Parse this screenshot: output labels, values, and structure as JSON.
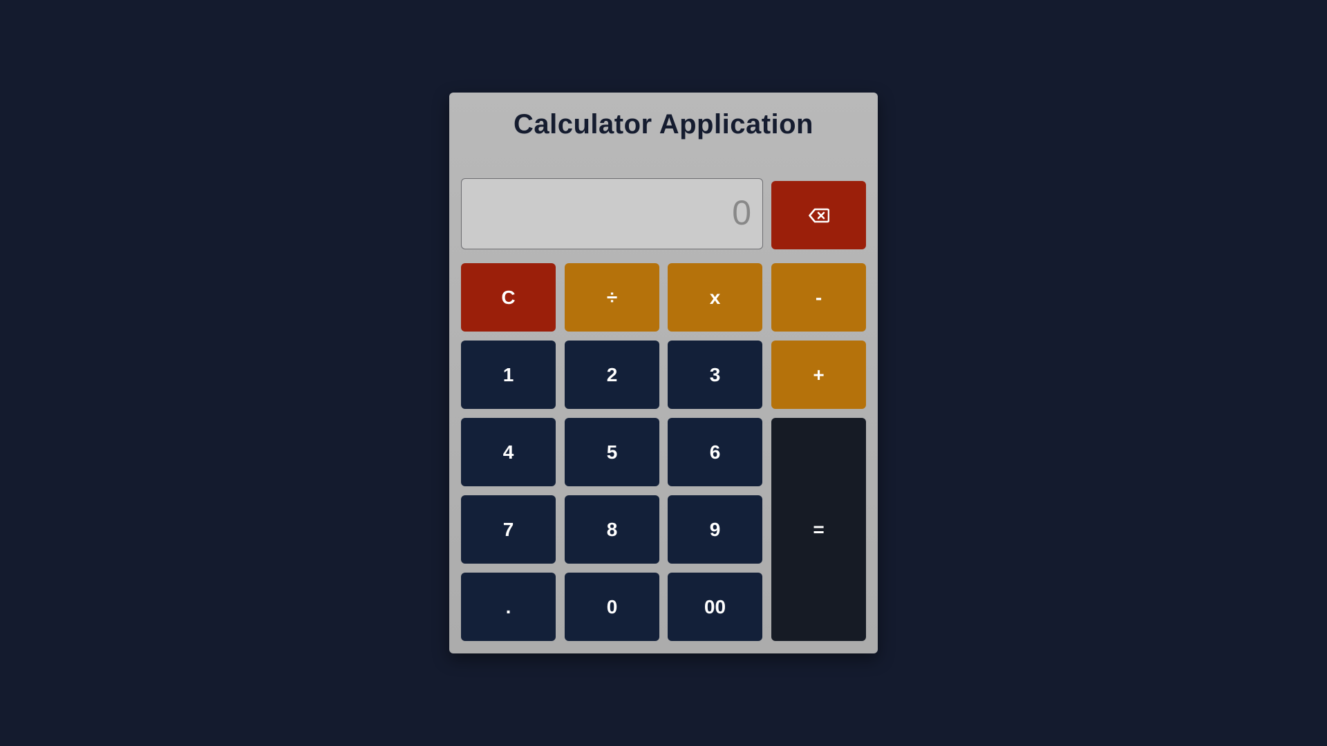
{
  "app": {
    "title": "Calculator Application"
  },
  "display": {
    "value": "0"
  },
  "keys": {
    "backspace_icon": "backspace-icon",
    "clear": "C",
    "divide": "÷",
    "multiply": "x",
    "subtract": "-",
    "add": "+",
    "one": "1",
    "two": "2",
    "three": "3",
    "four": "4",
    "five": "5",
    "six": "6",
    "seven": "7",
    "eight": "8",
    "nine": "9",
    "decimal": ".",
    "zero": "0",
    "double_zero": "00",
    "equals": "="
  },
  "colors": {
    "background": "#141b2e",
    "panel": "#b3b3b3",
    "danger": "#9b1f0a",
    "operator": "#b5720b",
    "digit": "#132039",
    "equals": "#161b25"
  }
}
